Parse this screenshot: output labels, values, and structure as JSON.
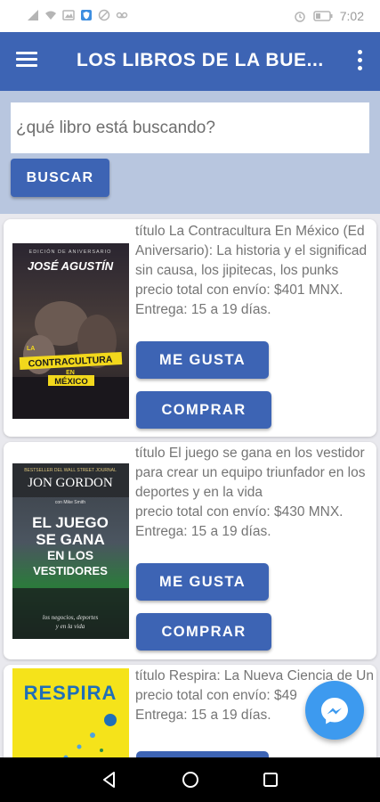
{
  "status_bar": {
    "time": "7:02"
  },
  "app_bar": {
    "title": "LOS LIBROS DE LA BUE...",
    "color": "#3d64b4"
  },
  "search": {
    "placeholder": "¿qué libro está buscando?",
    "button_label": "BUSCAR"
  },
  "books": [
    {
      "title_lines": [
        "título La Contracultura En México (Ed",
        "Aniversario): La historia y el significad",
        "sin causa, los jipitecas, los punks"
      ],
      "price": "precio total con envío: $401 MNX.",
      "delivery": "Entrega: 15 a 19 días.",
      "cover": {
        "edition": "EDICIÓN DE ANIVERSARIO",
        "author": "JOSÉ AGUSTÍN",
        "line1": "LA",
        "line2": "CONTRACULTURA",
        "line3": "EN",
        "line4": "MÉXICO"
      },
      "like_label": "ME GUSTA",
      "buy_label": "COMPRAR"
    },
    {
      "title_lines": [
        "título El juego se gana en los vestidor",
        "para crear un equipo triunfador en los",
        "deportes y en la vida"
      ],
      "price": "precio total con envío: $430 MNX.",
      "delivery": "Entrega: 15 a 19 días.",
      "cover": {
        "top": "BESTSELLER DEL WALL STREET JOURNAL",
        "author": "JON GORDON",
        "with": "con Mike Smith",
        "line1": "EL JUEGO",
        "line2": "SE GANA",
        "line3": "EN LOS",
        "line4": "VESTIDORES",
        "sub1": "los negocios, deportes",
        "sub2": "y en la vida"
      },
      "like_label": "ME GUSTA",
      "buy_label": "COMPRAR"
    },
    {
      "title_lines": [
        "título Respira: La Nueva Ciencia de Un"
      ],
      "price": "precio total con envío: $49",
      "delivery": "Entrega: 15 a 19 días.",
      "cover": {
        "title": "RESPIRA"
      }
    }
  ]
}
